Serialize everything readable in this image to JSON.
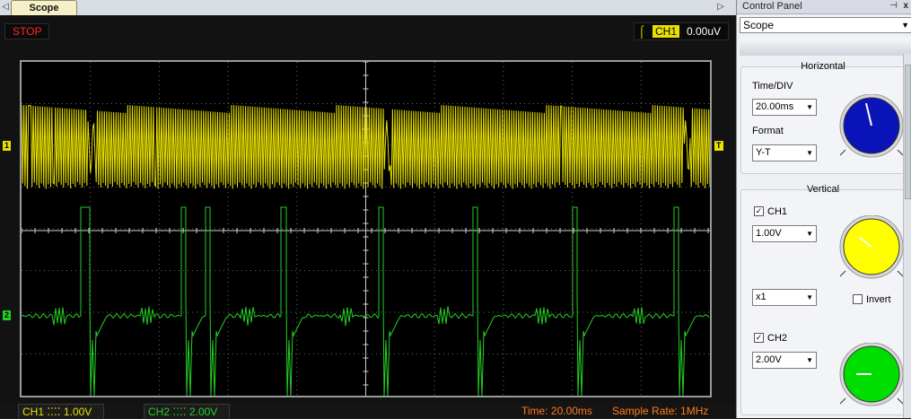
{
  "tabs": {
    "active": "Scope",
    "left_arrow": "◁",
    "right_arrow": "▷"
  },
  "status_top": {
    "stop": "STOP"
  },
  "trigger": {
    "edge": "⌠",
    "channel": "CH1",
    "level": "0.00uV"
  },
  "markers": {
    "ch1": "1",
    "ch2": "2",
    "trig": "T"
  },
  "bottom": {
    "ch1": "CH1 ⁚⁚⁚⁚  1.00V",
    "ch2": "CH2 ⁚⁚⁚⁚  2.00V",
    "time": "Time: 20.00ms",
    "sample_rate": "Sample Rate: 1MHz"
  },
  "panel": {
    "title": "Control Panel",
    "pin": "⊣",
    "close": "x",
    "mode": "Scope",
    "horizontal": {
      "title": "Horizontal",
      "time_div_label": "Time/DIV",
      "time_div": "20.00ms",
      "format_label": "Format",
      "format": "Y-T",
      "knob_color": "#0a14b8"
    },
    "vertical": {
      "title": "Vertical",
      "ch1_label": "CH1",
      "ch1_volts": "1.00V",
      "ch1_probe": "x1",
      "invert_label": "Invert",
      "ch1_color": "#ffff00",
      "ch2_label": "CH2",
      "ch2_volts": "2.00V",
      "ch2_color": "#00dd00"
    }
  },
  "colors": {
    "ch1": "#e8e000",
    "ch2": "#22d022",
    "grid": "#9a9a9a"
  }
}
